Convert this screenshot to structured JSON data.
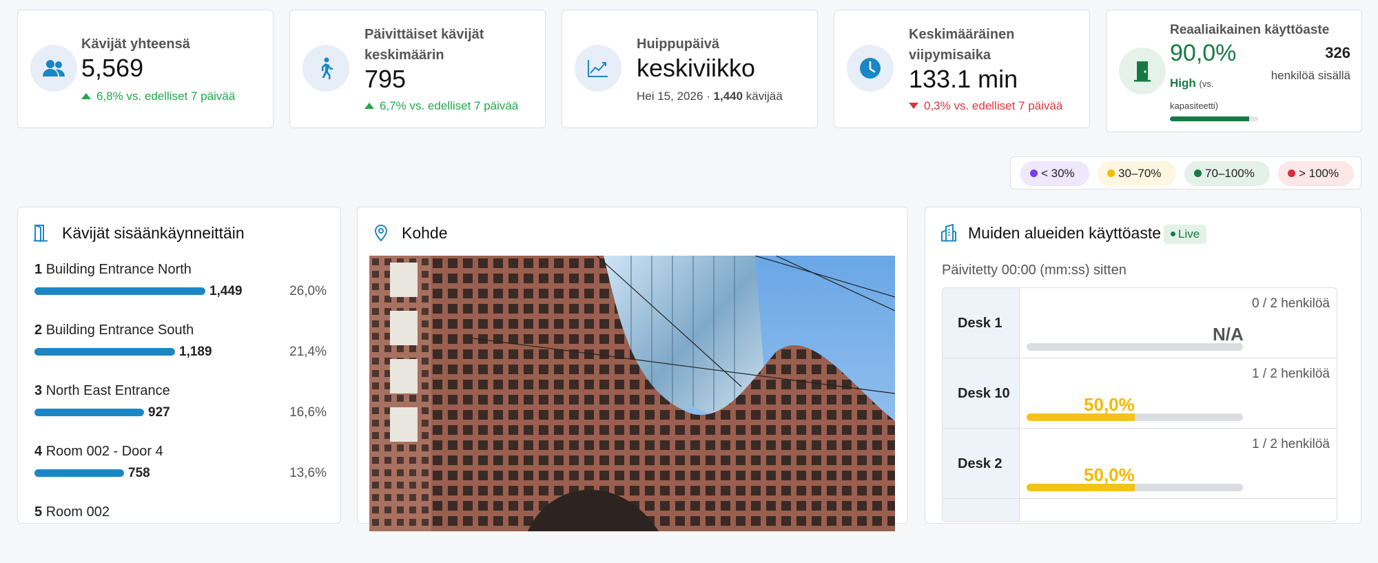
{
  "kpis": {
    "total": {
      "label": "Kävijät yhteensä",
      "value": "5,569",
      "trend": "6,8% vs. edelliset 7 päivää"
    },
    "daily": {
      "label_line1": "Päivittäiset kävijät",
      "label_line2": "keskimäärin",
      "value": "795",
      "trend": "6,7% vs. edelliset 7 päivää"
    },
    "peak": {
      "label": "Huippupäivä",
      "value": "keskiviikko",
      "sub_date": "Hei 15, 2026 · ",
      "sub_count": "1,440",
      "sub_unit": " kävijää"
    },
    "dwell": {
      "label_line1": "Keskimääräinen",
      "label_line2": "viipymisaika",
      "value": "133.1 min",
      "trend": "0,3% vs. edelliset 7 päivää"
    },
    "realtime": {
      "label": "Reaaliaikainen käyttöaste",
      "value": "90,0%",
      "level": "High",
      "level_note_1": "(vs.",
      "level_note_2": "kapasiteetti)",
      "count": "326",
      "count_label": "henkilöä sisällä",
      "fill_fraction": 0.9
    }
  },
  "legend": [
    {
      "label": "< 30%",
      "color": "#7c3aed",
      "bg": "#efe7fb"
    },
    {
      "label": "30–70%",
      "color": "#f5b800",
      "bg": "#fdf6e0"
    },
    {
      "label": "70–100%",
      "color": "#177a43",
      "bg": "#e4f1e8"
    },
    {
      "label": "> 100%",
      "color": "#d92d3a",
      "bg": "#fbe6e8"
    }
  ],
  "entrances": {
    "title": "Kävijät sisäänkäynneittäin",
    "items": [
      {
        "rank": "1",
        "name": "Building Entrance North",
        "count": "1,449",
        "pct": "26,0%",
        "value": 1449
      },
      {
        "rank": "2",
        "name": "Building Entrance South",
        "count": "1,189",
        "pct": "21,4%",
        "value": 1189
      },
      {
        "rank": "3",
        "name": "North East Entrance",
        "count": "927",
        "pct": "16,6%",
        "value": 927
      },
      {
        "rank": "4",
        "name": "Room 002 - Door 4",
        "count": "758",
        "pct": "13,6%",
        "value": 758
      },
      {
        "rank": "5",
        "name": "Room 002",
        "count": "",
        "pct": "",
        "value": 0
      }
    ]
  },
  "location": {
    "title": "Kohde"
  },
  "other": {
    "title": "Muiden alueiden käyttöaste",
    "badge": "Live",
    "updated": "Päivitetty 00:00 (mm:ss) sitten",
    "desks": [
      {
        "name": "Desk 1",
        "occupancy": "0 / 2 henkilöä",
        "pct_text": "N/A",
        "fraction": 0
      },
      {
        "name": "Desk 10",
        "occupancy": "1 / 2 henkilöä",
        "pct_text": "50,0%",
        "fraction": 0.5
      },
      {
        "name": "Desk 2",
        "occupancy": "1 / 2 henkilöä",
        "pct_text": "50,0%",
        "fraction": 0.5
      }
    ]
  },
  "colors": {
    "accent": "#1a86c6",
    "up": "#1fa84c",
    "down": "#d9363e",
    "high": "#177a43",
    "mid": "#f5c11b"
  }
}
